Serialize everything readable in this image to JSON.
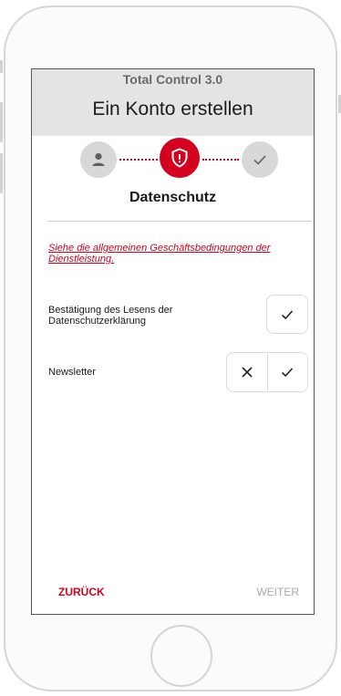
{
  "header": {
    "app_title": "Total Control 3.0",
    "page_title": "Ein Konto erstellen"
  },
  "stepper": {
    "steps": [
      {
        "icon": "person-icon",
        "state": "done"
      },
      {
        "icon": "shield-icon",
        "state": "active"
      },
      {
        "icon": "check-icon",
        "state": "upcoming"
      }
    ]
  },
  "section": {
    "title": "Datenschutz",
    "terms_link": "Siehe die allgemeinen Geschäftsbedingungen der Dienstleistung."
  },
  "rows": [
    {
      "label": "Bestätigung des Lesens der Datenschutzerklärung",
      "control": "check"
    },
    {
      "label": "Newsletter",
      "control": "reject-accept"
    }
  ],
  "footer": {
    "back_label": "ZURÜCK",
    "next_label": "WEITER"
  },
  "colors": {
    "accent": "#d4001e",
    "header_bg": "#e4e4e4",
    "inactive_step": "#d8d8d8",
    "disabled_text": "#a8a8a8"
  }
}
